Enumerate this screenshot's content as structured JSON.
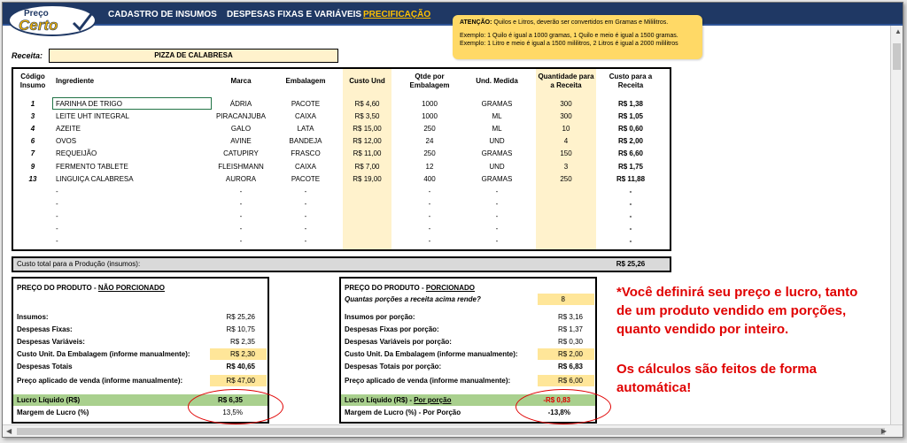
{
  "logo": {
    "line1": "Preço",
    "line2": "Certo"
  },
  "nav": [
    {
      "label": "CADASTRO DE INSUMOS"
    },
    {
      "label": "DESPESAS FIXAS E VARIÁVEIS"
    },
    {
      "label": "PRECIFICAÇÃO"
    }
  ],
  "attention": {
    "title": "ATENÇÃO:",
    "text": "Quilos e Litros, deverão ser convertidos em Gramas e Mililitros.",
    "ex1": "Exemplo: 1 Quilo é igual a 1000 gramas, 1 Quilo e meio é igual a 1500 gramas.",
    "ex2": "Exemplo: 1 Litro e meio é igual a 1500 mililitros, 2 Litros é igual a 2000 mililitros"
  },
  "receita": {
    "label": "Receita:",
    "value": "PIZZA DE CALABRESA"
  },
  "table": {
    "headers": {
      "codigo": "Código Insumo",
      "ingrediente": "Ingrediente",
      "marca": "Marca",
      "embalagem": "Embalagem",
      "custo": "Custo Und",
      "qtde": "Qtde por Embalagem",
      "und": "Und. Medida",
      "quant": "Quantidade para a Receita",
      "custo_receita": "Custo para a Receita"
    },
    "rows": [
      {
        "cod": "1",
        "ing": "FARINHA DE TRIGO",
        "marca": "ÁDRIA",
        "emb": "PACOTE",
        "custo": "R$ 4,60",
        "qtde": "1000",
        "und": "GRAMAS",
        "quant": "300",
        "cr": "R$ 1,38"
      },
      {
        "cod": "3",
        "ing": "LEITE UHT INTEGRAL",
        "marca": "PIRACANJUBA",
        "emb": "CAIXA",
        "custo": "R$ 3,50",
        "qtde": "1000",
        "und": "ML",
        "quant": "300",
        "cr": "R$ 1,05"
      },
      {
        "cod": "4",
        "ing": "AZEITE",
        "marca": "GALO",
        "emb": "LATA",
        "custo": "R$ 15,00",
        "qtde": "250",
        "und": "ML",
        "quant": "10",
        "cr": "R$ 0,60"
      },
      {
        "cod": "6",
        "ing": "OVOS",
        "marca": "AVINE",
        "emb": "BANDEJA",
        "custo": "R$ 12,00",
        "qtde": "24",
        "und": "UND",
        "quant": "4",
        "cr": "R$ 2,00"
      },
      {
        "cod": "7",
        "ing": "REQUEIJÃO",
        "marca": "CATUPIRY",
        "emb": "FRASCO",
        "custo": "R$ 11,00",
        "qtde": "250",
        "und": "GRAMAS",
        "quant": "150",
        "cr": "R$ 6,60"
      },
      {
        "cod": "9",
        "ing": "FERMENTO TABLETE",
        "marca": "FLEISHMANN",
        "emb": "CAIXA",
        "custo": "R$ 7,00",
        "qtde": "12",
        "und": "UND",
        "quant": "3",
        "cr": "R$ 1,75"
      },
      {
        "cod": "13",
        "ing": "LINGUIÇA CALABRESA",
        "marca": "AURORA",
        "emb": "PACOTE",
        "custo": "R$ 19,00",
        "qtde": "400",
        "und": "GRAMAS",
        "quant": "250",
        "cr": "R$ 11,88"
      },
      {
        "cod": "",
        "ing": "-",
        "marca": "-",
        "emb": "-",
        "custo": "",
        "qtde": "-",
        "und": "-",
        "quant": "",
        "cr": "-"
      },
      {
        "cod": "",
        "ing": "-",
        "marca": "-",
        "emb": "-",
        "custo": "",
        "qtde": "-",
        "und": "-",
        "quant": "",
        "cr": "-"
      },
      {
        "cod": "",
        "ing": "-",
        "marca": "-",
        "emb": "-",
        "custo": "",
        "qtde": "-",
        "und": "-",
        "quant": "",
        "cr": "-"
      },
      {
        "cod": "",
        "ing": "-",
        "marca": "-",
        "emb": "-",
        "custo": "",
        "qtde": "-",
        "und": "-",
        "quant": "",
        "cr": "-"
      },
      {
        "cod": "",
        "ing": "-",
        "marca": "-",
        "emb": "-",
        "custo": "",
        "qtde": "-",
        "und": "-",
        "quant": "",
        "cr": "-"
      }
    ]
  },
  "total": {
    "label": "Custo total para a Produção (insumos):",
    "value": "R$ 25,26"
  },
  "left_panel": {
    "title_prefix": "PREÇO DO PRODUTO - ",
    "title_suffix": "NÃO PORCIONADO",
    "insumos_l": "Insumos:",
    "insumos_v": "R$ 25,26",
    "fixas_l": "Despesas Fixas:",
    "fixas_v": "R$ 10,75",
    "var_l": "Despesas Variáveis:",
    "var_v": "R$ 2,35",
    "emb_l": "Custo Unit. Da Embalagem  (informe manualmente):",
    "emb_v": "R$ 2,30",
    "tot_l": "Despesas Totais",
    "tot_v": "R$ 40,65",
    "preco_l": "Preço aplicado de venda (informe manualmente):",
    "preco_v": "R$ 47,00",
    "lucro_l": "Lucro Líquido (R$)",
    "lucro_v": "R$ 6,35",
    "margem_l": "Margem de Lucro (%)",
    "margem_v": "13,5%"
  },
  "right_panel": {
    "title_prefix": "PREÇO DO PRODUTO - ",
    "title_suffix": "PORCIONADO",
    "porcoes_l": "Quantas porções a receita acima rende?",
    "porcoes_v": "8",
    "insumos_l": "Insumos por porção:",
    "insumos_v": "R$ 3,16",
    "fixas_l": "Despesas Fixas por porção:",
    "fixas_v": "R$ 1,37",
    "var_l": "Despesas Variáveis por porção:",
    "var_v": "R$ 0,30",
    "emb_l": "Custo Unit. Da Embalagem  (informe manualmente):",
    "emb_v": "R$ 2,00",
    "tot_l": "Despesas Totais por porção:",
    "tot_v": "R$ 6,83",
    "preco_l": "Preço aplicado de venda (informe manualmente):",
    "preco_v": "R$ 6,00",
    "lucro_l": "Lucro Líquido (R$) - ",
    "lucro_l2": "Por porção",
    "lucro_v": "-R$ 0,83",
    "margem_l": "Margem de Lucro (%) - Por Porção",
    "margem_v": "-13,8%"
  },
  "note": {
    "l1": "*Você definirá seu preço e lucro, tanto",
    "l2": "de um produto vendido em porções,",
    "l3": "quanto vendido por inteiro.",
    "l4": "Os cálculos são feitos de forma",
    "l5": "automática!"
  }
}
